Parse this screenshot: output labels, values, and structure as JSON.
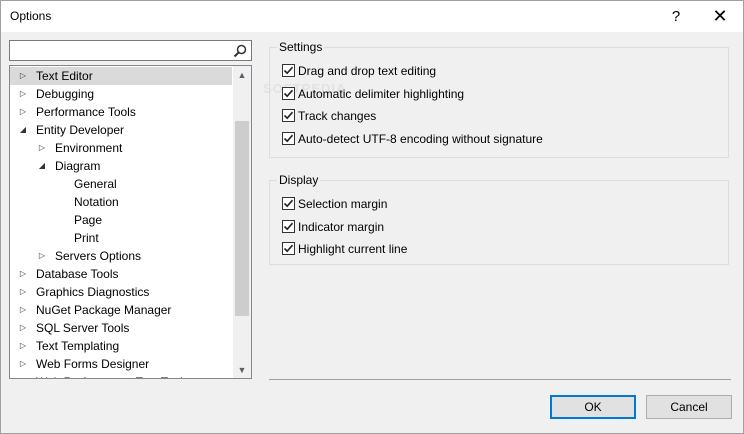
{
  "window": {
    "title": "Options",
    "help_glyph": "?",
    "close_glyph": "✕"
  },
  "search": {
    "value": "",
    "placeholder": ""
  },
  "tree": {
    "nodes": [
      {
        "label": "Text Editor",
        "level": 0,
        "arrow": "▷",
        "selected": true
      },
      {
        "label": "Debugging",
        "level": 0,
        "arrow": "▷"
      },
      {
        "label": "Performance Tools",
        "level": 0,
        "arrow": "▷"
      },
      {
        "label": "Entity Developer",
        "level": 0,
        "arrow": "◢"
      },
      {
        "label": "Environment",
        "level": 1,
        "arrow": "▷"
      },
      {
        "label": "Diagram",
        "level": 1,
        "arrow": "◢"
      },
      {
        "label": "General",
        "level": 2,
        "arrow": ""
      },
      {
        "label": "Notation",
        "level": 2,
        "arrow": ""
      },
      {
        "label": "Page",
        "level": 2,
        "arrow": ""
      },
      {
        "label": "Print",
        "level": 2,
        "arrow": ""
      },
      {
        "label": "Servers Options",
        "level": 1,
        "arrow": "▷"
      },
      {
        "label": "Database Tools",
        "level": 0,
        "arrow": "▷"
      },
      {
        "label": "Graphics Diagnostics",
        "level": 0,
        "arrow": "▷"
      },
      {
        "label": "NuGet Package Manager",
        "level": 0,
        "arrow": "▷"
      },
      {
        "label": "SQL Server Tools",
        "level": 0,
        "arrow": "▷"
      },
      {
        "label": "Text Templating",
        "level": 0,
        "arrow": "▷"
      },
      {
        "label": "Web Forms Designer",
        "level": 0,
        "arrow": "▷"
      },
      {
        "label": "Web Performance Test Tools",
        "level": 0,
        "arrow": "▷"
      }
    ],
    "scroll_up_glyph": "▲",
    "scroll_down_glyph": "▼"
  },
  "settings": {
    "title": "Settings",
    "items": [
      {
        "label": "Drag and drop text editing",
        "checked": true
      },
      {
        "label": "Automatic delimiter highlighting",
        "checked": true
      },
      {
        "label": "Track changes",
        "checked": true
      },
      {
        "label": "Auto-detect UTF-8 encoding without signature",
        "checked": true
      }
    ]
  },
  "display": {
    "title": "Display",
    "items": [
      {
        "label": "Selection margin",
        "checked": true
      },
      {
        "label": "Indicator margin",
        "checked": true
      },
      {
        "label": "Highlight current line",
        "checked": true
      }
    ]
  },
  "buttons": {
    "ok": "OK",
    "cancel": "Cancel"
  },
  "watermark": "SOFTPEDIA",
  "colors": {
    "accent": "#0078d7",
    "selection": "#dadada"
  }
}
